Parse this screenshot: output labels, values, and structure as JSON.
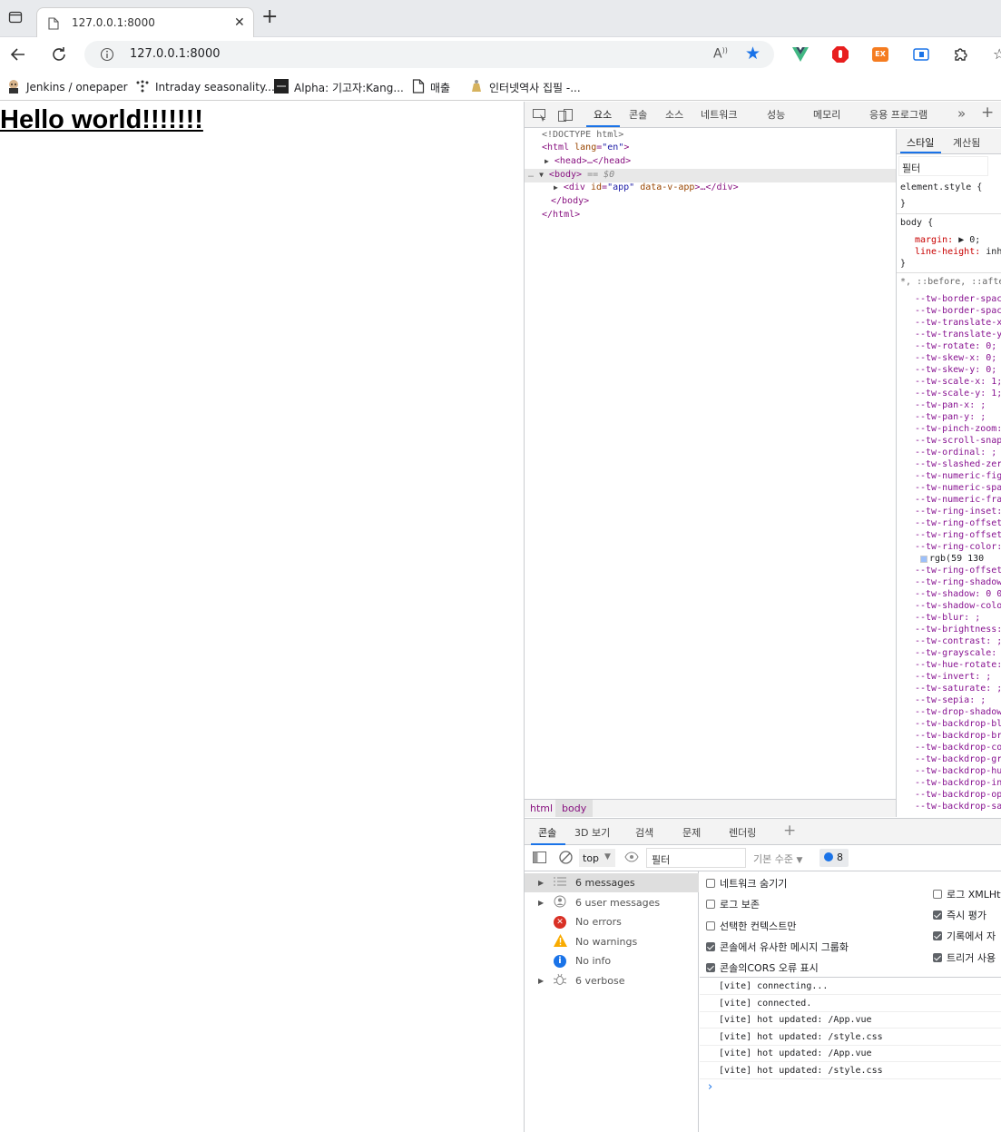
{
  "browser": {
    "tab_title": "127.0.0.1:8000",
    "address": "127.0.0.1:8000",
    "bookmarks": [
      {
        "label": "Jenkins / onepaper",
        "icon": "jenkins-icon"
      },
      {
        "label": "Intraday seasonality...",
        "icon": "dots-icon"
      },
      {
        "label": "Alpha: 기고자:Kang...",
        "icon": "alpha-icon"
      },
      {
        "label": "매출",
        "icon": "page-icon"
      },
      {
        "label": "인터넷역사 집필 -...",
        "icon": "folder-icon"
      }
    ]
  },
  "page": {
    "heading": "Hello world!!!!!!!"
  },
  "devtools": {
    "tabs": [
      "요소",
      "콘솔",
      "소스",
      "네트워크",
      "성능",
      "메모리",
      "응용 프로그램"
    ],
    "elements": {
      "doctype": "<!DOCTYPE html>",
      "html_open": "<html",
      "html_attr_name": "lang",
      "html_attr_value": "\"en\"",
      "html_open_end": ">",
      "head": "<head>…</head>",
      "body": "<body>",
      "body_marker": "== $0",
      "div_open": "<div",
      "div_attr_name": "id",
      "div_attr_value": "\"app\"",
      "div_attr2": "data-v-app",
      "div_rest": ">…</div>",
      "body_close": "</body>",
      "html_close": "</html>"
    },
    "styles": {
      "tabs": [
        "스타일",
        "계산됨"
      ],
      "filter_placeholder": "필터",
      "element_style": "element.style {",
      "close_brace": "}",
      "body_selector": "body {",
      "margin_prop": "margin:",
      "margin_val": "▶ 0;",
      "lineheight_prop": "line-height:",
      "lineheight_val": "inh",
      "universal_selector": "*, ::before, ::afte",
      "tw_props": [
        "--tw-border-spac",
        "--tw-border-spac",
        "--tw-translate-x",
        "--tw-translate-y",
        "--tw-rotate: 0;",
        "--tw-skew-x: 0;",
        "--tw-skew-y: 0;",
        "--tw-scale-x: 1;",
        "--tw-scale-y: 1;",
        "--tw-pan-x: ;",
        "--tw-pan-y: ;",
        "--tw-pinch-zoom:",
        "--tw-scroll-snap",
        "--tw-ordinal: ;",
        "--tw-slashed-zer",
        "--tw-numeric-fig",
        "--tw-numeric-spa",
        "--tw-numeric-fra",
        "--tw-ring-inset:",
        "--tw-ring-offset",
        "--tw-ring-offset",
        "--tw-ring-color:",
        "rgb(59 130",
        "--tw-ring-offset",
        "--tw-ring-shadow",
        "--tw-shadow: 0 0",
        "--tw-shadow-colo",
        "--tw-blur: ;",
        "--tw-brightness:",
        "--tw-contrast: ;",
        "--tw-grayscale:",
        "--tw-hue-rotate:",
        "--tw-invert: ;",
        "--tw-saturate: ;",
        "--tw-sepia: ;",
        "--tw-drop-shadow",
        "--tw-backdrop-bl",
        "--tw-backdrop-br",
        "--tw-backdrop-co",
        "--tw-backdrop-gr",
        "--tw-backdrop-hu",
        "--tw-backdrop-in",
        "--tw-backdrop-op",
        "--tw-backdrop-sa"
      ]
    },
    "breadcrumbs": [
      "html",
      "body"
    ],
    "drawer_tabs": [
      "콘솔",
      "3D 보기",
      "검색",
      "문제",
      "렌더링"
    ],
    "console": {
      "context": "top",
      "filter_placeholder": "필터",
      "level": "기본 수준",
      "issues_count": "8",
      "sidebar": [
        {
          "label": "6 messages",
          "icon": "list-icon"
        },
        {
          "label": "6 user messages",
          "icon": "user-icon"
        },
        {
          "label": "No errors",
          "icon": "error-icon"
        },
        {
          "label": "No warnings",
          "icon": "warning-icon"
        },
        {
          "label": "No info",
          "icon": "info-icon"
        },
        {
          "label": "6 verbose",
          "icon": "bug-icon"
        }
      ],
      "settings_left": [
        {
          "label": "네트워크 숨기기",
          "checked": false
        },
        {
          "label": "로그 보존",
          "checked": false
        },
        {
          "label": "선택한 컨텍스트만",
          "checked": false
        },
        {
          "label": "콘솔에서 유사한 메시지 그룹화",
          "checked": true
        },
        {
          "label": "콘솔의CORS 오류 표시",
          "checked": true
        }
      ],
      "settings_right": [
        {
          "label": "로그 XMLHtt",
          "checked": false
        },
        {
          "label": "즉시 평가",
          "checked": true
        },
        {
          "label": "기록에서 자",
          "checked": true
        },
        {
          "label": "트리거 사용",
          "checked": true
        }
      ],
      "messages": [
        "[vite] connecting...",
        "[vite] connected.",
        "[vite] hot updated: /App.vue",
        "[vite] hot updated: /style.css",
        "[vite] hot updated: /App.vue",
        "[vite] hot updated: /style.css"
      ],
      "prompt": "›"
    }
  }
}
